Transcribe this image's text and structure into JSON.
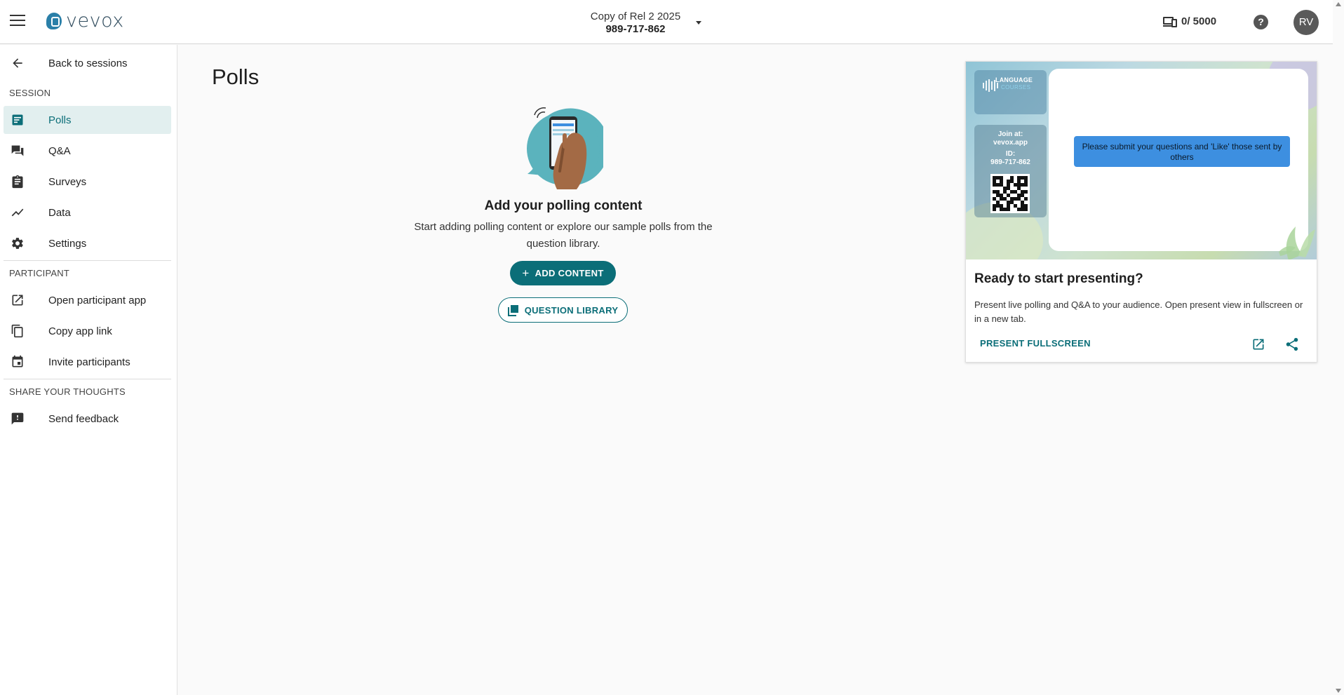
{
  "header": {
    "logo_text": "vevox",
    "session_name": "Copy of Rel 2 2025",
    "session_code": "989-717-862",
    "device_count": "0/ 5000",
    "help_glyph": "?",
    "avatar_initials": "RV"
  },
  "sidebar": {
    "back_label": "Back to sessions",
    "session_section": "SESSION",
    "session_items": [
      {
        "label": "Polls",
        "icon": "polls-icon",
        "active": true
      },
      {
        "label": "Q&A",
        "icon": "qa-icon"
      },
      {
        "label": "Surveys",
        "icon": "clipboard-icon"
      },
      {
        "label": "Data",
        "icon": "chart-line-icon"
      },
      {
        "label": "Settings",
        "icon": "gear-icon"
      }
    ],
    "participant_section": "PARTICIPANT",
    "participant_items": [
      {
        "label": "Open participant app",
        "icon": "open-external-icon"
      },
      {
        "label": "Copy app link",
        "icon": "copy-icon"
      },
      {
        "label": "Invite participants",
        "icon": "calendar-icon"
      }
    ],
    "feedback_section": "SHARE YOUR THOUGHTS",
    "feedback_items": [
      {
        "label": "Send feedback",
        "icon": "feedback-icon"
      }
    ]
  },
  "main": {
    "title": "Polls",
    "empty_heading": "Add your polling content",
    "empty_description": "Start adding polling content or explore our sample polls from the question library.",
    "add_content_label": "ADD CONTENT",
    "question_library_label": "QUESTION LIBRARY"
  },
  "present_card": {
    "preview": {
      "brand_title": "LANGUAGE",
      "brand_sub": "COURSES",
      "join_at": "Join at:",
      "join_url": "vevox.app",
      "id_label": "ID:",
      "id_value": "989-717-862",
      "slide_message": "Please submit your questions and 'Like' those sent by others"
    },
    "title": "Ready to start presenting?",
    "description": "Present live polling and Q&A to your audience. Open present view in fullscreen or in a new tab.",
    "present_label": "PRESENT FULLSCREEN"
  },
  "colors": {
    "accent": "#0b6e78",
    "active_bg": "#e2efef",
    "slide_message_bg": "#3d8fe0"
  }
}
